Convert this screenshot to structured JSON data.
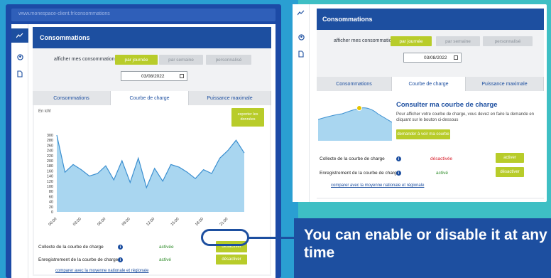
{
  "left": {
    "browser_title": "www.monespace-client.fr/consommations",
    "header_title": "Consommations",
    "afficher_label": "afficher mes consommations",
    "periods": [
      "par journée",
      "par semaine",
      "personnalisé"
    ],
    "date_value": "03/08/2022",
    "tabs": [
      "Consommations",
      "Courbe de charge",
      "Puissance maximale"
    ],
    "unit_label": "En kW",
    "export_label": "exporter les données",
    "collecte_label": "Collecte de la courbe de charge",
    "collecte_status": "activée",
    "collecte_button": "désactiver",
    "enregistrement_label": "Enregistrement de la courbe de charge",
    "enregistrement_status": "activé",
    "enregistrement_button": "désactiver",
    "compare_link": "comparer avec la moyenne nationale et régionale"
  },
  "right": {
    "header_title": "Consommations",
    "afficher_label": "afficher mes consommations",
    "periods": [
      "par journée",
      "par semaine",
      "personnalisé"
    ],
    "date_value": "03/08/2022",
    "tabs": [
      "Consommations",
      "Courbe de charge",
      "Puissance maximale"
    ],
    "consult_title": "Consulter ma courbe de charge",
    "consult_desc": "Pour afficher votre courbe de charge, vous devez en faire la demande en cliquant sur le bouton ci-dessous",
    "consult_button": "demander à voir ma courbe",
    "collecte_label": "Collecte de la courbe de charge",
    "collecte_status": "désactivée",
    "collecte_button": "activer",
    "enregistrement_label": "Enregistrement de la courbe de charge",
    "enregistrement_status": "activé",
    "enregistrement_button": "désactiver",
    "compare_link": "comparer avec la moyenne nationale et régionale"
  },
  "callout_text": "You can enable or disable it at any time",
  "colors": {
    "brand_blue": "#1d4fa0",
    "accent_green": "#b8cc2a",
    "teal_bg": "#3ebfc4",
    "area_fill": "#a9d6f0",
    "line": "#3b8fd0"
  },
  "icons": [
    "chart-icon",
    "user-icon",
    "document-icon",
    "info-icon",
    "calendar-icon"
  ],
  "chart_data": {
    "type": "area",
    "ylabel": "En kW",
    "ylim": [
      0,
      300
    ],
    "y_ticks": [
      0,
      20,
      40,
      60,
      80,
      100,
      120,
      140,
      160,
      180,
      200,
      220,
      240,
      260,
      280,
      300
    ],
    "x_ticks": [
      "00:00",
      "03:00",
      "06:00",
      "09:00",
      "12:00",
      "15:00",
      "18:00",
      "21:00"
    ],
    "x": [
      0,
      1,
      2,
      3,
      4,
      5,
      6,
      7,
      8,
      9,
      10,
      11,
      12,
      13,
      14,
      15,
      16,
      17,
      18,
      19,
      20,
      21,
      22,
      23
    ],
    "values": [
      300,
      155,
      185,
      165,
      140,
      150,
      180,
      125,
      200,
      115,
      210,
      95,
      170,
      120,
      185,
      175,
      155,
      130,
      165,
      150,
      210,
      240,
      280,
      230
    ]
  }
}
